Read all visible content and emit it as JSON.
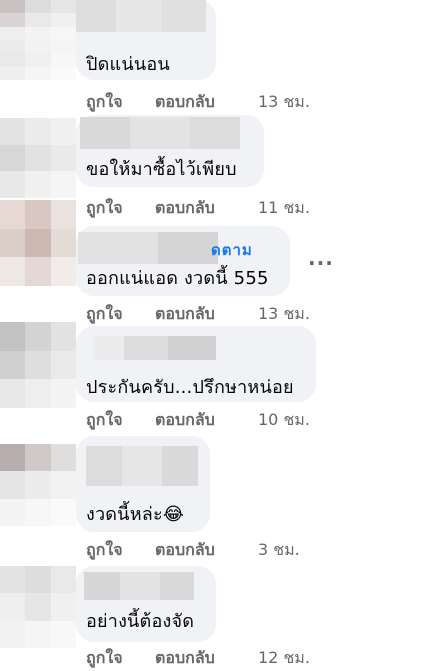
{
  "comments": [
    {
      "text": "ปิดแน่นอน",
      "like_label": "ถูกใจ",
      "reply_label": "ตอบกลับ",
      "time": "13 ชม."
    },
    {
      "text": "ขอให้มาซื้อไว้เพียบ",
      "like_label": "ถูกใจ",
      "reply_label": "ตอบกลับ",
      "time": "11 ชม."
    },
    {
      "text": "ออกแน่แอด งวดนี้ 555",
      "follow_label": "ดตาม",
      "more_label": "...",
      "like_label": "ถูกใจ",
      "reply_label": "ตอบกลับ",
      "time": "13 ชม."
    },
    {
      "text": "ประกันครับ...ปรึกษาหน่อย",
      "like_label": "ถูกใจ",
      "reply_label": "ตอบกลับ",
      "time": "10 ชม."
    },
    {
      "text": "งวดนี้หล่ะ😂",
      "like_label": "ถูกใจ",
      "reply_label": "ตอบกลับ",
      "time": "3 ชม."
    },
    {
      "text": "อย่างนี้ต้องจัด",
      "like_label": "ถูกใจ",
      "reply_label": "ตอบกลับ",
      "time": "12 ชม."
    }
  ],
  "colors": {
    "link": "#1877f2",
    "meta": "#65676b",
    "bubble": "#f0f2f5",
    "text": "#050505"
  }
}
